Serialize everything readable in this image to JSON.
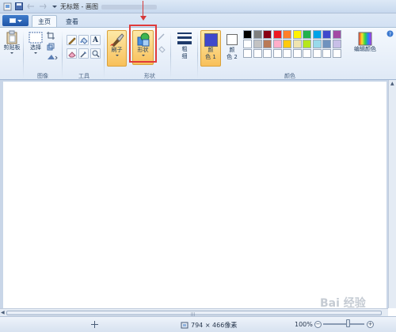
{
  "window": {
    "title": "无标题 - 画图"
  },
  "tabs": [
    {
      "label": "主页"
    },
    {
      "label": "查看"
    }
  ],
  "ribbon": {
    "clipboard": {
      "label": "剪贴板"
    },
    "image": {
      "select_label": "选择",
      "group_label": "图像"
    },
    "tools": {
      "group_label": "工具"
    },
    "brushes": {
      "label": "刷子"
    },
    "shapes": {
      "label": "形状",
      "group_label": "形状"
    },
    "size": {
      "label_line1": "粗",
      "label_line2": "细"
    },
    "color1": {
      "label_line1": "颜",
      "label_line2": "色 1"
    },
    "color2": {
      "label_line1": "颜",
      "label_line2": "色 2"
    },
    "colors": {
      "group_label": "颜色"
    },
    "edit_colors": {
      "label": "编辑颜色"
    }
  },
  "palette": {
    "row1": [
      "#000000",
      "#7f7f7f",
      "#880015",
      "#ed1c24",
      "#ff7f27",
      "#fff200",
      "#22b14c",
      "#00a2e8",
      "#3f48cc",
      "#a349a4"
    ],
    "row2": [
      "#ffffff",
      "#c3c3c3",
      "#b97a57",
      "#ffaec9",
      "#ffc90e",
      "#efe4b0",
      "#b5e61d",
      "#99d9ea",
      "#7092be",
      "#c8bfe7"
    ],
    "row3": [
      "#ffffff",
      "#ffffff",
      "#ffffff",
      "#ffffff",
      "#ffffff",
      "#ffffff",
      "#ffffff",
      "#ffffff",
      "#ffffff",
      "#ffffff"
    ],
    "color1": "#3f48cc",
    "color2": "#ffffff"
  },
  "status": {
    "dimensions": "794 × 466像素",
    "zoom": "100%"
  },
  "watermark": "Bai 经验"
}
